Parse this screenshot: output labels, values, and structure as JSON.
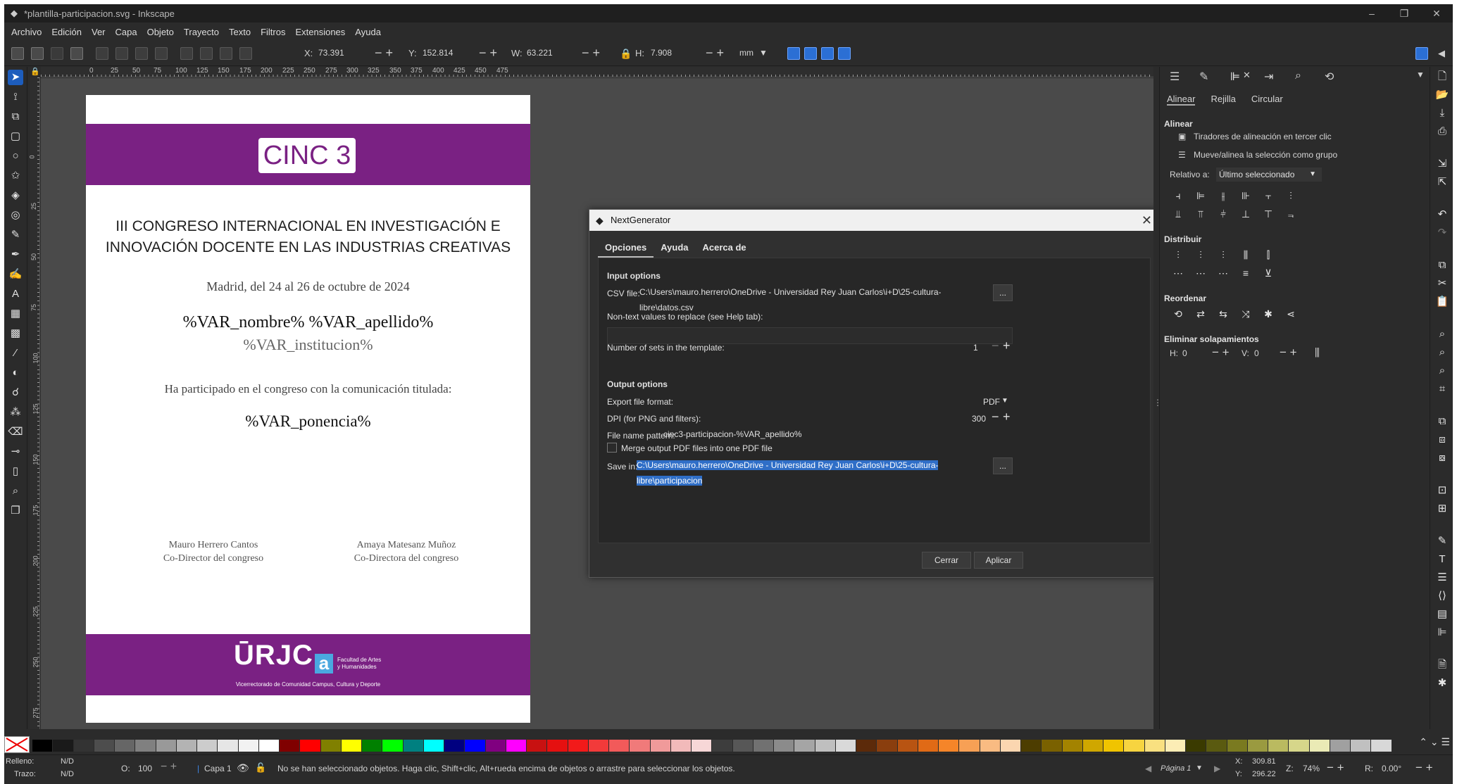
{
  "window": {
    "title": "*plantilla-participacion.svg - Inkscape",
    "controls": {
      "minimize": "–",
      "restore": "❐",
      "close": "✕"
    }
  },
  "menu": [
    "Archivo",
    "Edición",
    "Ver",
    "Capa",
    "Objeto",
    "Trayecto",
    "Texto",
    "Filtros",
    "Extensiones",
    "Ayuda"
  ],
  "toolbar": {
    "x_label": "X:",
    "x_value": "73.391",
    "y_label": "Y:",
    "y_value": "152.814",
    "w_label": "W:",
    "w_value": "63.221",
    "h_label": "H:",
    "h_value": "7.908",
    "unit": "mm"
  },
  "ruler_h": [
    "0",
    "25",
    "50",
    "75",
    "100",
    "125",
    "150",
    "175",
    "200",
    "225",
    "250",
    "275",
    "300",
    "325",
    "350",
    "375",
    "400",
    "425",
    "450",
    "475"
  ],
  "ruler_v": [
    "0",
    "25",
    "50",
    "75",
    "100",
    "125",
    "150",
    "175",
    "200",
    "225",
    "250",
    "275"
  ],
  "document": {
    "cinc": "CINC 3",
    "title_line1": "III CONGRESO INTERNACIONAL EN INVESTIGACIÓN E",
    "title_line2": "INNOVACIÓN DOCENTE EN LAS INDUSTRIAS CREATIVAS",
    "date": "Madrid, del 24 al 26 de octubre de 2024",
    "name": "%VAR_nombre% %VAR_apellido%",
    "institution": "%VAR_institucion%",
    "participation": "Ha participado en el congreso con la comunicación titulada:",
    "paper": "%VAR_ponencia%",
    "sig1_name": "Mauro Herrero Cantos",
    "sig1_role": "Co-Director del congreso",
    "sig2_name": "Amaya Matesanz Muñoz",
    "sig2_role": "Co-Directora del congreso",
    "urjc": "ŪRJC",
    "a_logo": "a",
    "facultad_line1": "Facultad de Artes",
    "facultad_line2": "y Humanidades",
    "vicerrectorado": "Vicerrectorado de Comunidad Campus, Cultura y Deporte"
  },
  "dialog": {
    "title": "NextGenerator",
    "tabs": [
      "Opciones",
      "Ayuda",
      "Acerca de"
    ],
    "input_options": "Input options",
    "csv_label": "CSV file:",
    "csv_value": "C:\\Users\\mauro.herrero\\OneDrive - Universidad Rey Juan Carlos\\i+D\\25-cultura-libre\\datos.csv",
    "browse": "...",
    "nontext_label": "Non-text values to replace (see Help tab):",
    "sets_label": "Number of sets in the template:",
    "sets_value": "1",
    "output_options": "Output options",
    "format_label": "Export file format:",
    "format_value": "PDF",
    "dpi_label": "DPI (for PNG and filters):",
    "dpi_value": "300",
    "pattern_label": "File name pattern:",
    "pattern_value": "cinc3-participacion-%VAR_apellido%",
    "merge_label": "Merge output PDF files into one PDF file",
    "save_label": "Save in:",
    "save_value": "C:\\Users\\mauro.herrero\\OneDrive - Universidad Rey Juan Carlos\\i+D\\25-cultura-libre\\participacion",
    "close_btn": "Cerrar",
    "apply_btn": "Aplicar"
  },
  "align_panel": {
    "subtabs": [
      "Alinear",
      "Rejilla",
      "Circular"
    ],
    "alinear": "Alinear",
    "opt1": "Tiradores de alineación en tercer clic",
    "opt2": "Mueve/alinea la selección como grupo",
    "relative_label": "Relativo a:",
    "relative_value": "Último seleccionado",
    "distribuir": "Distribuir",
    "reordenar": "Reordenar",
    "overlaps": "Eliminar solapamientos",
    "h_label": "H:",
    "h_value": "0",
    "v_label": "V:",
    "v_value": "0"
  },
  "status": {
    "fill_label": "Relleno:",
    "fill_value": "N/D",
    "stroke_label": "Trazo:",
    "stroke_value": "N/D",
    "opacity_label": "O:",
    "opacity_value": "100",
    "layer": "Capa 1",
    "message": "No se han seleccionado objetos. Haga clic, Shift+clic, Alt+rueda encima de objetos o arrastre para seleccionar los objetos.",
    "page": "Página 1",
    "x_label": "X:",
    "x_value": "309.81",
    "y_label": "Y:",
    "y_value": "296.22",
    "zoom_label": "Z:",
    "zoom_value": "74%",
    "rot_label": "R:",
    "rot_value": "0.00°"
  },
  "colors": {
    "accent": "#7a2183",
    "selection": "#2f6ec7",
    "palette": [
      "#000000",
      "#1a1a1a",
      "#333333",
      "#4d4d4d",
      "#666666",
      "#808080",
      "#999999",
      "#b3b3b3",
      "#cccccc",
      "#e6e6e6",
      "#f2f2f2",
      "#ffffff",
      "#800000",
      "#ff0000",
      "#808000",
      "#ffff00",
      "#008000",
      "#00ff00",
      "#008080",
      "#00ffff",
      "#000080",
      "#0000ff",
      "#800080",
      "#ff00ff",
      "#c81111",
      "#e51010",
      "#f21a1a",
      "#f23a3a",
      "#f25a5a",
      "#f07a7a",
      "#f09a9a",
      "#f2baba",
      "#f7d7d7",
      "#3d3d3d",
      "#575757",
      "#717171",
      "#8b8b8b",
      "#a5a5a5",
      "#bfbfbf",
      "#d9d9d9",
      "#5c2a0a",
      "#8a3e0e",
      "#b85412",
      "#e06a16",
      "#f58529",
      "#f7a055",
      "#f9bb82",
      "#fbd6b0",
      "#4d3d00",
      "#7a6100",
      "#a38300",
      "#cfa700",
      "#f0c400",
      "#f7d440",
      "#f9e080",
      "#fcedb5",
      "#3a3a00",
      "#5a5a10",
      "#7a7a20",
      "#9a9a40",
      "#baba60",
      "#d6d68a",
      "#eaeab5",
      "#a0a0a0",
      "#c0c0c0",
      "#d8d8d8"
    ]
  }
}
